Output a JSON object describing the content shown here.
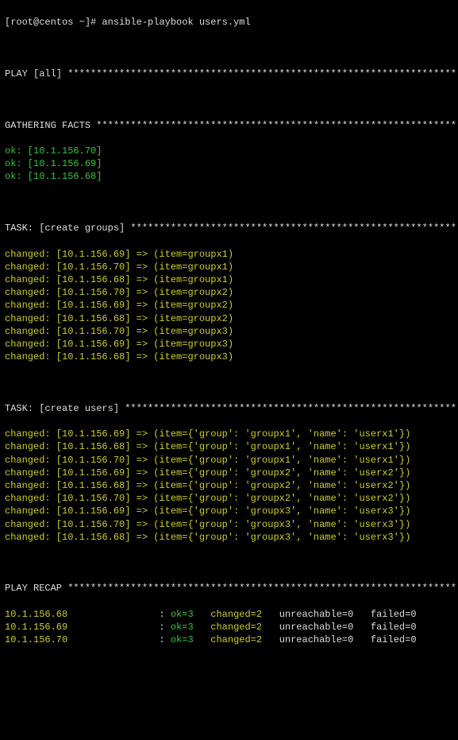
{
  "prompt": "[root@centos ~]#",
  "command": "ansible-playbook users.yml",
  "play_header": "PLAY [all] ******************************************************************** ",
  "gathering_header": "GATHERING FACTS *************************************************************** ",
  "facts": [
    "ok: [10.1.156.70]",
    "ok: [10.1.156.69]",
    "ok: [10.1.156.68]"
  ],
  "task_groups_header": "TASK: [create groups] ********************************************************* ",
  "groups": [
    "changed: [10.1.156.69] => (item=groupx1)",
    "changed: [10.1.156.70] => (item=groupx1)",
    "changed: [10.1.156.68] => (item=groupx1)",
    "changed: [10.1.156.70] => (item=groupx2)",
    "changed: [10.1.156.69] => (item=groupx2)",
    "changed: [10.1.156.68] => (item=groupx2)",
    "changed: [10.1.156.70] => (item=groupx3)",
    "changed: [10.1.156.69] => (item=groupx3)",
    "changed: [10.1.156.68] => (item=groupx3)"
  ],
  "task_users_header": "TASK: [create users] ********************************************************** ",
  "users": [
    "changed: [10.1.156.69] => (item={'group': 'groupx1', 'name': 'userx1'})",
    "changed: [10.1.156.68] => (item={'group': 'groupx1', 'name': 'userx1'})",
    "changed: [10.1.156.70] => (item={'group': 'groupx1', 'name': 'userx1'})",
    "changed: [10.1.156.69] => (item={'group': 'groupx2', 'name': 'userx2'})",
    "changed: [10.1.156.68] => (item={'group': 'groupx2', 'name': 'userx2'})",
    "changed: [10.1.156.70] => (item={'group': 'groupx2', 'name': 'userx2'})",
    "changed: [10.1.156.69] => (item={'group': 'groupx3', 'name': 'userx3'})",
    "changed: [10.1.156.70] => (item={'group': 'groupx3', 'name': 'userx3'})",
    "changed: [10.1.156.68] => (item={'group': 'groupx3', 'name': 'userx3'})"
  ],
  "recap_header": "PLAY RECAP ******************************************************************** ",
  "recap": [
    {
      "host": "10.1.156.68",
      "ok": "ok=3",
      "changed": "changed=2",
      "unreachable": "unreachable=0",
      "failed": "failed=0"
    },
    {
      "host": "10.1.156.69",
      "ok": "ok=3",
      "changed": "changed=2",
      "unreachable": "unreachable=0",
      "failed": "failed=0"
    },
    {
      "host": "10.1.156.70",
      "ok": "ok=3",
      "changed": "changed=2",
      "unreachable": "unreachable=0",
      "failed": "failed=0"
    }
  ]
}
